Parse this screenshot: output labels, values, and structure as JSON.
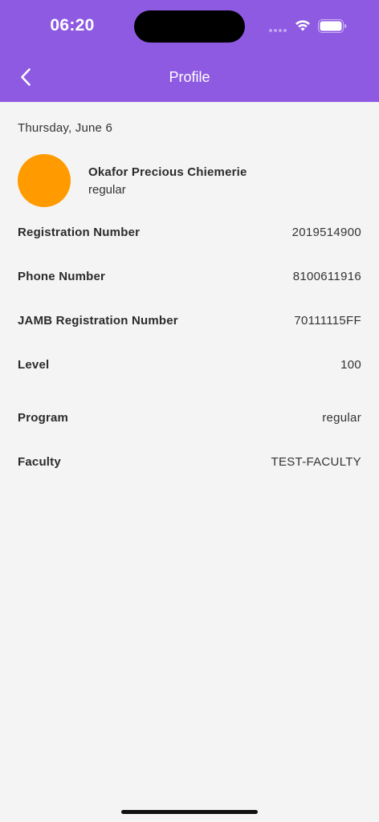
{
  "status_bar": {
    "time": "06:20"
  },
  "header": {
    "title": "Profile",
    "background_color": "#8e5ae2",
    "back_icon": "chevron-left-icon"
  },
  "date": "Thursday, June 6",
  "profile": {
    "name": "Okafor Precious Chiemerie",
    "program": "regular",
    "avatar_color": "#ff9b00"
  },
  "details": [
    {
      "label": "Registration Number",
      "value": "2019514900"
    },
    {
      "label": "Phone Number",
      "value": "8100611916"
    },
    {
      "label": "JAMB Registration Number",
      "value": "70111115FF"
    },
    {
      "label": "Level",
      "value": "100"
    },
    {
      "label": "Program",
      "value": "regular"
    },
    {
      "label": "Faculty",
      "value": "TEST-FACULTY"
    }
  ]
}
